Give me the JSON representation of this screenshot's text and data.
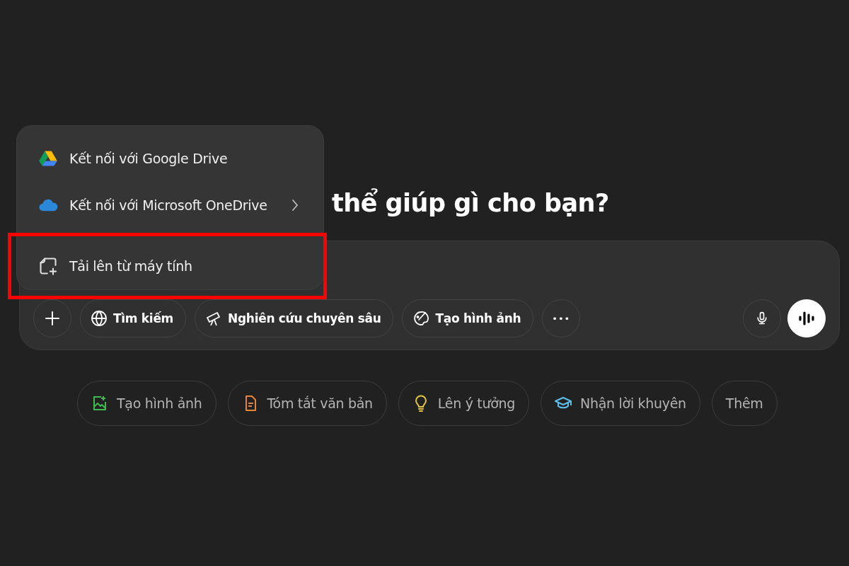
{
  "heading": "thể giúp gì cho bạn?",
  "attach_menu": {
    "items": [
      {
        "kind": "google-drive",
        "label": "Kết nối với Google Drive",
        "has_submenu": false,
        "highlighted": false
      },
      {
        "kind": "onedrive",
        "label": "Kết nối với Microsoft OneDrive",
        "has_submenu": true,
        "highlighted": false
      },
      {
        "kind": "upload",
        "label": "Tải lên từ máy tính",
        "has_submenu": false,
        "highlighted": true
      }
    ]
  },
  "composer": {
    "tools": [
      {
        "kind": "plus"
      },
      {
        "kind": "globe",
        "label": "Tìm kiếm"
      },
      {
        "kind": "telescope",
        "label": "Nghiên cứu chuyên sâu"
      },
      {
        "kind": "paint",
        "label": "Tạo hình ảnh"
      },
      {
        "kind": "more",
        "label": "•••"
      }
    ],
    "actions": [
      {
        "kind": "mic"
      },
      {
        "kind": "voice"
      }
    ]
  },
  "suggestions": [
    {
      "kind": "image",
      "label": "Tạo hình ảnh",
      "color": "#3fb950"
    },
    {
      "kind": "doc",
      "label": "Tóm tắt văn bản",
      "color": "#e8833a"
    },
    {
      "kind": "bulb",
      "label": "Lên ý tưởng",
      "color": "#e2c541"
    },
    {
      "kind": "cap",
      "label": "Nhận lời khuyên",
      "color": "#5bc0eb"
    },
    {
      "kind": "none",
      "label": "Thêm"
    }
  ]
}
